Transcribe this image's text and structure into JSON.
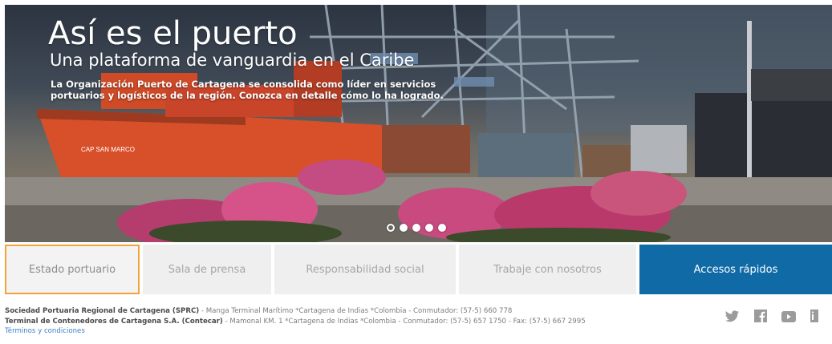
{
  "hero": {
    "title": "Así es el puerto",
    "subtitle": "Una plataforma de vanguardia en el Caribe",
    "description": "La Organización Puerto de Cartagena se consolida como líder en servicios portuarios y logísticos de la región. Conozca en detalle cómo lo ha logrado.",
    "ship_name": "CAP SAN MARCO",
    "slides_total": 5,
    "active_slide": 1
  },
  "tabs": [
    {
      "label": "Estado portuario"
    },
    {
      "label": "Sala de prensa"
    },
    {
      "label": "Responsabilidad social"
    },
    {
      "label": "Trabaje con nosotros"
    },
    {
      "label": "Accesos rápidos"
    }
  ],
  "footer": {
    "line1_bold": "Sociedad Portuaria Regional de Cartagena (SPRC)",
    "line1_rest": " - Manga Terminal Marítimo *Cartagena de Indias *Colombia - Conmutador: (57-5) 660 778",
    "line2_bold": "Terminal de Contenedores de Cartagena S.A. (Contecar)",
    "line2_rest": " - Mamonal KM. 1 *Cartagena de Indias *Colombia - Conmutador: (57-5) 657 1750 - Fax: (57-5) 667 2995",
    "terms": "Términos y condiciones"
  },
  "social": [
    "twitter-icon",
    "facebook-icon",
    "youtube-icon",
    "linkedin-icon"
  ],
  "colors": {
    "accent_blue": "#0f6aa6",
    "active_border": "#f2a33a",
    "tab_bg": "#efefef"
  }
}
